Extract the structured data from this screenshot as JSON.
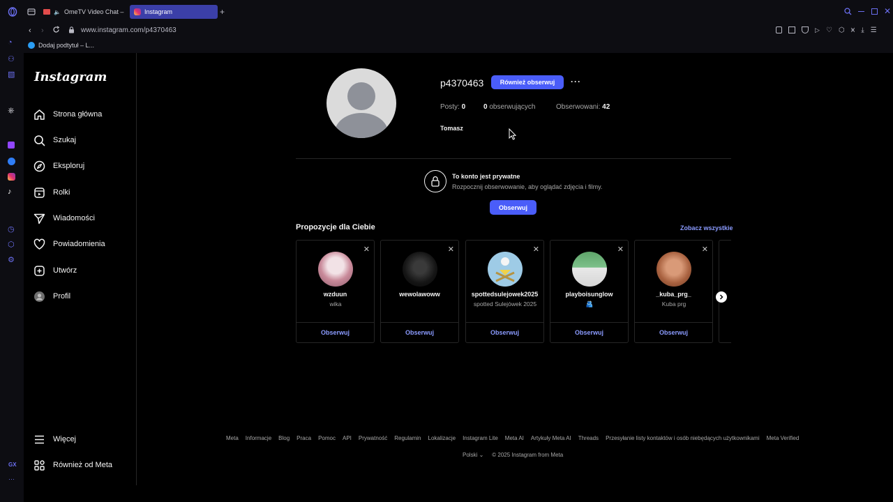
{
  "browser": {
    "tabs": [
      {
        "label": "OmeTV Video Chat –"
      },
      {
        "label": "Instagram"
      }
    ],
    "url": "www.instagram.com/p4370463",
    "bookmark": "Dodaj podtytuł – L...",
    "sidebar_label": "GX"
  },
  "nav": {
    "logo": "Instagram",
    "items": [
      {
        "label": "Strona główna",
        "icon": "home-icon"
      },
      {
        "label": "Szukaj",
        "icon": "search-icon"
      },
      {
        "label": "Eksploruj",
        "icon": "compass-icon"
      },
      {
        "label": "Rolki",
        "icon": "reels-icon"
      },
      {
        "label": "Wiadomości",
        "icon": "send-icon"
      },
      {
        "label": "Powiadomienia",
        "icon": "heart-icon"
      },
      {
        "label": "Utwórz",
        "icon": "plus-icon"
      },
      {
        "label": "Profil",
        "icon": "avatar-icon"
      }
    ],
    "more": "Więcej",
    "also_from_meta": "Również od Meta"
  },
  "profile": {
    "username": "p4370463",
    "follow_back_label": "Również obserwuj",
    "posts_label": "Posty:",
    "posts_count": "0",
    "followers_count": "0",
    "followers_label": "obserwujących",
    "following_label": "Obserwowani:",
    "following_count": "42",
    "full_name": "Tomasz"
  },
  "private": {
    "title": "To konto jest prywatne",
    "subtitle": "Rozpocznij obserwowanie, aby oglądać zdjęcia i filmy.",
    "follow_label": "Obserwuj"
  },
  "suggestions": {
    "title": "Propozycje dla Ciebie",
    "see_all": "Zobacz wszystkie",
    "cards": [
      {
        "name": "wzduun",
        "sub": "wika",
        "action": "Obserwuj"
      },
      {
        "name": "wewolawoww",
        "sub": "",
        "action": "Obserwuj"
      },
      {
        "name": "spottedsulejowek2025",
        "sub": "spotted Sulejówek 2025",
        "action": "Obserwuj"
      },
      {
        "name": "playboisunglow",
        "sub": "🫂",
        "action": "Obserwuj"
      },
      {
        "name": "_kuba_prg_",
        "sub": "Kuba prg",
        "action": "Obserwuj"
      }
    ]
  },
  "footer": {
    "links": [
      "Meta",
      "Informacje",
      "Blog",
      "Praca",
      "Pomoc",
      "API",
      "Prywatność",
      "Regulamin",
      "Lokalizacje",
      "Instagram Lite",
      "Meta AI",
      "Artykuły Meta AI",
      "Threads",
      "Przesyłanie listy kontaktów i osób niebędących użytkownikami",
      "Meta Verified"
    ],
    "language": "Polski",
    "copyright": "© 2025 Instagram from Meta"
  }
}
